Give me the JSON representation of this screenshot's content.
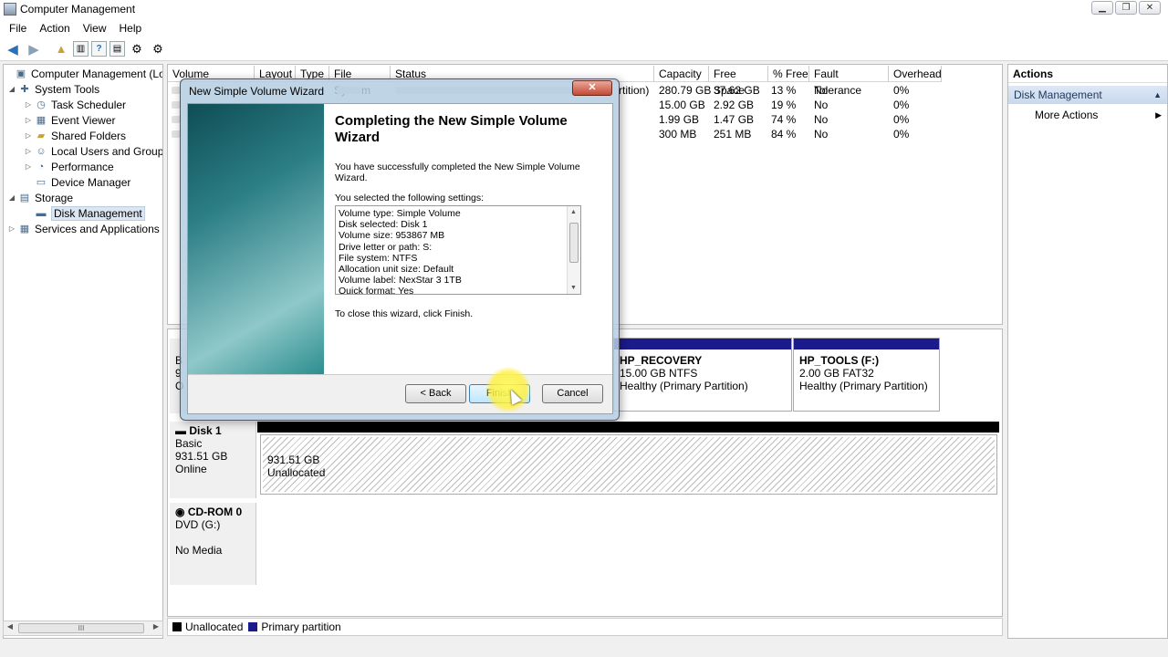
{
  "window": {
    "title": "Computer Management",
    "min": "▁",
    "max": "❐",
    "close": "✕"
  },
  "menu": [
    "File",
    "Action",
    "View",
    "Help"
  ],
  "tree": {
    "root": "Computer Management (Local",
    "system_tools": "System Tools",
    "task_scheduler": "Task Scheduler",
    "event_viewer": "Event Viewer",
    "shared_folders": "Shared Folders",
    "local_users": "Local Users and Groups",
    "performance": "Performance",
    "device_manager": "Device Manager",
    "storage": "Storage",
    "disk_management": "Disk Management",
    "services": "Services and Applications",
    "scroll_grip": "III"
  },
  "volumes": {
    "headers": [
      "Volume",
      "Layout",
      "Type",
      "File System",
      "Status",
      "Capacity",
      "Free Space",
      "% Free",
      "Fault Tolerance",
      "Overhead"
    ],
    "rows": [
      {
        "status_tail": "rtition)",
        "capacity": "280.79 GB",
        "free": "37.62 GB",
        "pct": "13 %",
        "fault": "No",
        "overhead": "0%"
      },
      {
        "status_tail": "",
        "capacity": "15.00 GB",
        "free": "2.92 GB",
        "pct": "19 %",
        "fault": "No",
        "overhead": "0%"
      },
      {
        "status_tail": "",
        "capacity": "1.99 GB",
        "free": "1.47 GB",
        "pct": "74 %",
        "fault": "No",
        "overhead": "0%"
      },
      {
        "status_tail": "",
        "capacity": "300 MB",
        "free": "251 MB",
        "pct": "84 %",
        "fault": "No",
        "overhead": "0%"
      }
    ]
  },
  "disk0": {
    "label_initials": [
      "B",
      "9",
      "O"
    ],
    "recovery": {
      "name": "HP_RECOVERY",
      "size": "15.00 GB NTFS",
      "status": "Healthy (Primary Partition)"
    },
    "tools": {
      "name": "HP_TOOLS  (F:)",
      "size": "2.00 GB FAT32",
      "status": "Healthy (Primary Partition)"
    }
  },
  "disk1": {
    "name": "Disk 1",
    "type": "Basic",
    "size": "931.51 GB",
    "state": "Online",
    "part_size": "931.51 GB",
    "part_status": "Unallocated"
  },
  "cdrom": {
    "name": "CD-ROM 0",
    "type": "DVD (G:)",
    "media": "No Media"
  },
  "legend": {
    "unallocated": "Unallocated",
    "primary": "Primary partition",
    "unalloc_color": "#000000",
    "primary_color": "#1b1b8c"
  },
  "actions": {
    "title": "Actions",
    "section": "Disk Management",
    "more": "More Actions"
  },
  "wizard": {
    "title": "New Simple Volume Wizard",
    "close": "✕",
    "heading": "Completing the New Simple Volume Wizard",
    "success": "You have successfully completed the New Simple Volume Wizard.",
    "selected": "You selected the following settings:",
    "settings": [
      "Volume type: Simple Volume",
      "Disk selected: Disk 1",
      "Volume size: 953867 MB",
      "Drive letter or path: S:",
      "File system: NTFS",
      "Allocation unit size: Default",
      "Volume label: NexStar 3 1TB",
      "Quick format: Yes"
    ],
    "close_hint": "To close this wizard, click Finish.",
    "back": "< Back",
    "finish": "Finish",
    "cancel": "Cancel"
  }
}
